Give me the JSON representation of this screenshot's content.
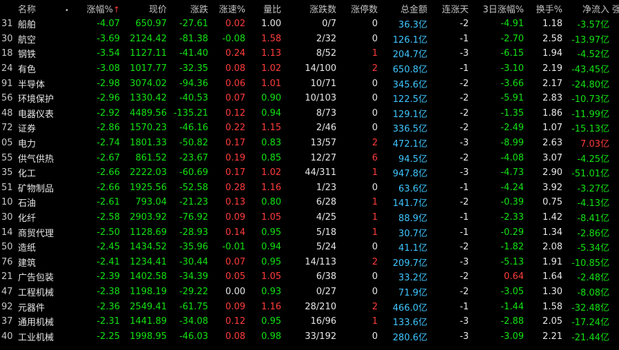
{
  "headers": {
    "name": "名称",
    "dot": "•",
    "change_pct": "涨幅%",
    "sort_arrow": "↑",
    "price": "现价",
    "change": "涨跌",
    "speed": "涨速%",
    "vol_ratio": "量比",
    "up_down": "涨跌数",
    "limit_up": "涨停数",
    "amount": "总金额",
    "streak": "连涨天",
    "pct3d": "3日涨幅%",
    "turnover": "换手%",
    "netflow": "净流入",
    "strength": "强"
  },
  "rows": [
    {
      "code": "31",
      "name": "船舶",
      "pct": "-4.07",
      "price": "650.97",
      "chg": "-27.61",
      "speed": "0.02",
      "vr": "1.00",
      "ud": "0/7",
      "lu": "0",
      "amt": "36.3亿",
      "streak": "-2",
      "p3": "-4.91",
      "to": "1.18",
      "nf": "-3.57亿"
    },
    {
      "code": "30",
      "name": "航空",
      "pct": "-3.69",
      "price": "2124.42",
      "chg": "-81.38",
      "speed": "-0.08",
      "vr": "1.58",
      "ud": "2/32",
      "lu": "0",
      "amt": "126.1亿",
      "streak": "-1",
      "p3": "-2.70",
      "to": "2.58",
      "nf": "-13.97亿"
    },
    {
      "code": "18",
      "name": "钢铁",
      "pct": "-3.54",
      "price": "1127.11",
      "chg": "-41.40",
      "speed": "0.24",
      "vr": "1.13",
      "ud": "8/52",
      "lu": "1",
      "amt": "204.7亿",
      "streak": "-3",
      "p3": "-6.15",
      "to": "1.94",
      "nf": "-4.52亿"
    },
    {
      "code": "24",
      "name": "有色",
      "pct": "-3.08",
      "price": "1017.77",
      "chg": "-32.35",
      "speed": "0.08",
      "vr": "1.02",
      "ud": "14/100",
      "lu": "2",
      "amt": "650.8亿",
      "streak": "-1",
      "p3": "-3.10",
      "to": "2.19",
      "nf": "-43.45亿"
    },
    {
      "code": "91",
      "name": "半导体",
      "pct": "-2.98",
      "price": "3074.02",
      "chg": "-94.36",
      "speed": "0.06",
      "vr": "1.01",
      "ud": "10/71",
      "lu": "0",
      "amt": "345.6亿",
      "streak": "-2",
      "p3": "-3.66",
      "to": "2.17",
      "nf": "-24.80亿"
    },
    {
      "code": "56",
      "name": "环境保护",
      "pct": "-2.96",
      "price": "1330.42",
      "chg": "-40.53",
      "speed": "0.07",
      "vr": "0.90",
      "ud": "10/103",
      "lu": "0",
      "amt": "122.5亿",
      "streak": "-2",
      "p3": "-5.91",
      "to": "2.83",
      "nf": "-10.73亿"
    },
    {
      "code": "48",
      "name": "电器仪表",
      "pct": "-2.92",
      "price": "4489.56",
      "chg": "-135.21",
      "speed": "0.12",
      "vr": "0.94",
      "ud": "8/73",
      "lu": "0",
      "amt": "129.1亿",
      "streak": "-2",
      "p3": "-1.35",
      "to": "1.86",
      "nf": "-11.99亿"
    },
    {
      "code": "72",
      "name": "证券",
      "pct": "-2.86",
      "price": "1570.23",
      "chg": "-46.16",
      "speed": "0.22",
      "vr": "1.15",
      "ud": "2/46",
      "lu": "0",
      "amt": "336.5亿",
      "streak": "-2",
      "p3": "-2.49",
      "to": "1.07",
      "nf": "-15.13亿"
    },
    {
      "code": "05",
      "name": "电力",
      "pct": "-2.74",
      "price": "1801.33",
      "chg": "-50.82",
      "speed": "0.17",
      "vr": "0.83",
      "ud": "13/57",
      "lu": "2",
      "amt": "472.1亿",
      "streak": "-3",
      "p3": "-8.99",
      "to": "2.63",
      "nf": "7.03亿"
    },
    {
      "code": "55",
      "name": "供气供热",
      "pct": "-2.67",
      "price": "861.52",
      "chg": "-23.67",
      "speed": "0.19",
      "vr": "0.85",
      "ud": "12/27",
      "lu": "6",
      "amt": "94.5亿",
      "streak": "-2",
      "p3": "-4.08",
      "to": "3.07",
      "nf": "-4.25亿"
    },
    {
      "code": "35",
      "name": "化工",
      "pct": "-2.66",
      "price": "2222.03",
      "chg": "-60.69",
      "speed": "0.17",
      "vr": "1.02",
      "ud": "44/311",
      "lu": "1",
      "amt": "947.8亿",
      "streak": "-3",
      "p3": "-4.73",
      "to": "2.90",
      "nf": "-51.01亿"
    },
    {
      "code": "51",
      "name": "矿物制品",
      "pct": "-2.66",
      "price": "1925.56",
      "chg": "-52.58",
      "speed": "0.28",
      "vr": "1.16",
      "ud": "1/23",
      "lu": "0",
      "amt": "63.6亿",
      "streak": "-1",
      "p3": "-4.24",
      "to": "3.92",
      "nf": "-3.27亿"
    },
    {
      "code": "10",
      "name": "石油",
      "pct": "-2.61",
      "price": "793.04",
      "chg": "-21.23",
      "speed": "0.13",
      "vr": "0.80",
      "ud": "6/28",
      "lu": "1",
      "amt": "141.7亿",
      "streak": "-2",
      "p3": "-0.39",
      "to": "0.75",
      "nf": "-4.13亿"
    },
    {
      "code": "30",
      "name": "化纤",
      "pct": "-2.58",
      "price": "2903.92",
      "chg": "-76.92",
      "speed": "0.09",
      "vr": "1.05",
      "ud": "4/25",
      "lu": "1",
      "amt": "88.9亿",
      "streak": "-1",
      "p3": "-2.33",
      "to": "1.42",
      "nf": "-8.41亿"
    },
    {
      "code": "14",
      "name": "商贸代理",
      "pct": "-2.50",
      "price": "1128.69",
      "chg": "-28.93",
      "speed": "0.14",
      "vr": "0.95",
      "ud": "5/18",
      "lu": "1",
      "amt": "30.7亿",
      "streak": "-1",
      "p3": "-0.29",
      "to": "1.34",
      "nf": "-2.86亿"
    },
    {
      "code": "50",
      "name": "造纸",
      "pct": "-2.45",
      "price": "1434.52",
      "chg": "-35.96",
      "speed": "-0.01",
      "vr": "0.94",
      "ud": "5/24",
      "lu": "0",
      "amt": "41.1亿",
      "streak": "-2",
      "p3": "-1.82",
      "to": "2.08",
      "nf": "-5.34亿"
    },
    {
      "code": "76",
      "name": "建筑",
      "pct": "-2.41",
      "price": "1234.41",
      "chg": "-30.44",
      "speed": "0.07",
      "vr": "0.95",
      "ud": "14/113",
      "lu": "2",
      "amt": "209.7亿",
      "streak": "-3",
      "p3": "-5.13",
      "to": "1.91",
      "nf": "-10.85亿"
    },
    {
      "code": "21",
      "name": "广告包装",
      "pct": "-2.39",
      "price": "1402.58",
      "chg": "-34.39",
      "speed": "0.05",
      "vr": "1.05",
      "ud": "6/38",
      "lu": "0",
      "amt": "33.2亿",
      "streak": "-2",
      "p3": "0.64",
      "to": "1.64",
      "nf": "-2.48亿"
    },
    {
      "code": "47",
      "name": "工程机械",
      "pct": "-2.38",
      "price": "1198.19",
      "chg": "-29.22",
      "speed": "0.00",
      "vr": "0.93",
      "ud": "0/27",
      "lu": "0",
      "amt": "71.9亿",
      "streak": "-2",
      "p3": "-3.05",
      "to": "1.30",
      "nf": "-8.08亿"
    },
    {
      "code": "92",
      "name": "元器件",
      "pct": "-2.36",
      "price": "2549.41",
      "chg": "-61.75",
      "speed": "0.09",
      "vr": "1.16",
      "ud": "28/210",
      "lu": "2",
      "amt": "466.0亿",
      "streak": "-1",
      "p3": "-1.44",
      "to": "1.58",
      "nf": "-32.48亿"
    },
    {
      "code": "37",
      "name": "通用机械",
      "pct": "-2.31",
      "price": "1441.89",
      "chg": "-34.08",
      "speed": "0.12",
      "vr": "0.95",
      "ud": "16/96",
      "lu": "1",
      "amt": "133.6亿",
      "streak": "-3",
      "p3": "-2.88",
      "to": "2.05",
      "nf": "-17.24亿"
    },
    {
      "code": "40",
      "name": "工业机械",
      "pct": "-2.25",
      "price": "1998.95",
      "chg": "-46.03",
      "speed": "0.08",
      "vr": "0.98",
      "ud": "33/192",
      "lu": "0",
      "amt": "280.6亿",
      "streak": "-3",
      "p3": "-3.09",
      "to": "2.21",
      "nf": "-21.44亿"
    }
  ]
}
